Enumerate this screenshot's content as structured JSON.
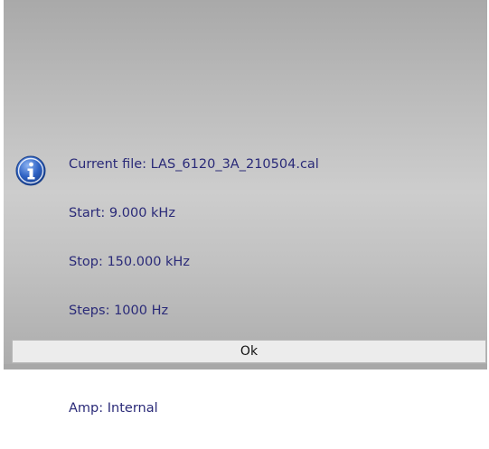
{
  "dialog": {
    "icon": "info-icon",
    "message_lines": [
      "Current file: LAS_6120_3A_210504.cal",
      "Start: 9.000 kHz",
      "Stop: 150.000 kHz",
      "Steps: 1000 Hz",
      "Amp: Internal"
    ],
    "ok_label": "Ok",
    "colors": {
      "text": "#2a2a78",
      "icon": "#2f63c4"
    }
  }
}
